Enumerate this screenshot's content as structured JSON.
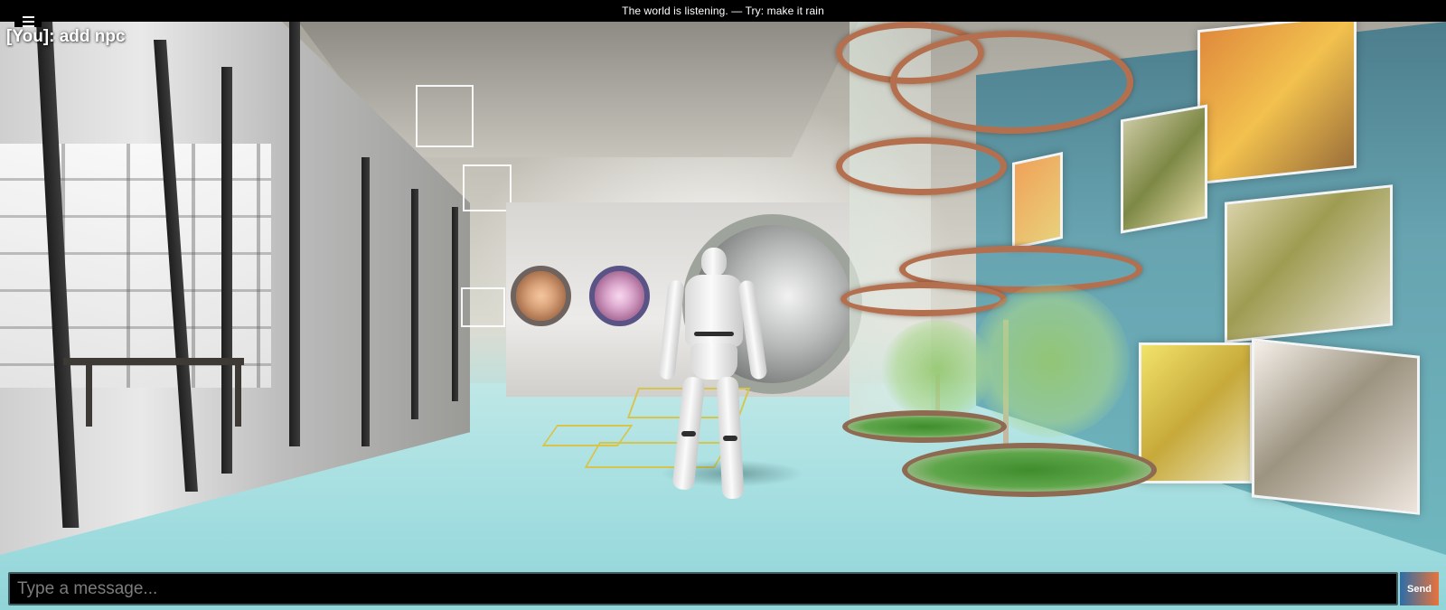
{
  "topbar": {
    "hint": "The world is listening. — Try: make it rain"
  },
  "menu": {
    "icon": "hamburger-menu-icon"
  },
  "chat": {
    "log": [
      {
        "text": "[You]: add npc"
      }
    ],
    "input_placeholder": "Type a message...",
    "input_value": "",
    "send_label": "Send"
  },
  "colors": {
    "topbar_bg": "#000000",
    "input_bg": "#000000",
    "input_border": "#3f5e62",
    "send_gradient_start": "#2c6ea8",
    "send_gradient_end": "#e9733c"
  }
}
